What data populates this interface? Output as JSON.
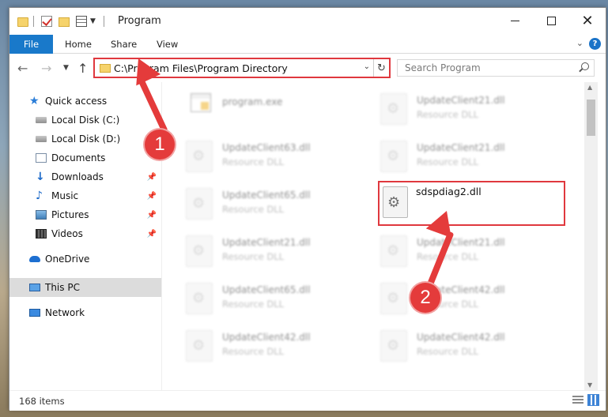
{
  "window": {
    "title": "Program"
  },
  "ribbon": {
    "file": "File",
    "home": "Home",
    "share": "Share",
    "view": "View"
  },
  "address": {
    "path": "C:\\Program Files\\Program Directory"
  },
  "search": {
    "placeholder": "Search Program"
  },
  "navpane": {
    "items": [
      {
        "label": "Quick access",
        "icon": "star-icon"
      },
      {
        "label": "Local Disk (C:)",
        "icon": "drive-icon"
      },
      {
        "label": "Local Disk (D:)",
        "icon": "drive-icon"
      },
      {
        "label": "Documents",
        "icon": "documents-icon"
      },
      {
        "label": "Downloads",
        "icon": "downloads-icon",
        "pinned": true
      },
      {
        "label": "Music",
        "icon": "music-icon",
        "pinned": true
      },
      {
        "label": "Pictures",
        "icon": "pictures-icon",
        "pinned": true
      },
      {
        "label": "Videos",
        "icon": "videos-icon",
        "pinned": true
      },
      {
        "label": "OneDrive",
        "icon": "cloud-icon"
      },
      {
        "label": "This PC",
        "icon": "computer-icon",
        "selected": true
      },
      {
        "label": "Network",
        "icon": "network-icon"
      }
    ]
  },
  "files": {
    "left": [
      {
        "name": "program.exe",
        "type": ""
      },
      {
        "name": "UpdateClient63.dll",
        "type": "Resource DLL"
      },
      {
        "name": "UpdateClient65.dll",
        "type": "Resource DLL"
      },
      {
        "name": "UpdateClient21.dll",
        "type": "Resource DLL"
      },
      {
        "name": "UpdateClient65.dll",
        "type": "Resource DLL"
      },
      {
        "name": "UpdateClient42.dll",
        "type": "Resource DLL"
      }
    ],
    "right": [
      {
        "name": "UpdateClient21.dll",
        "type": "Resource DLL"
      },
      {
        "name": "UpdateClient21.dll",
        "type": "Resource DLL"
      },
      {
        "name": "UpdateClient21.dll",
        "type": "Resource DLL"
      },
      {
        "name": "UpdateClient42.dll",
        "type": "Resource DLL"
      },
      {
        "name": "UpdateClient42.dll",
        "type": "Resource DLL"
      }
    ],
    "highlighted": {
      "name": "sdspdiag2.dll"
    }
  },
  "annotations": {
    "step1": "1",
    "step2": "2"
  },
  "status": {
    "items": "168 items"
  },
  "colors": {
    "accent": "#1979ca",
    "highlight": "#e0383e",
    "selected": "#dcdcdc"
  }
}
